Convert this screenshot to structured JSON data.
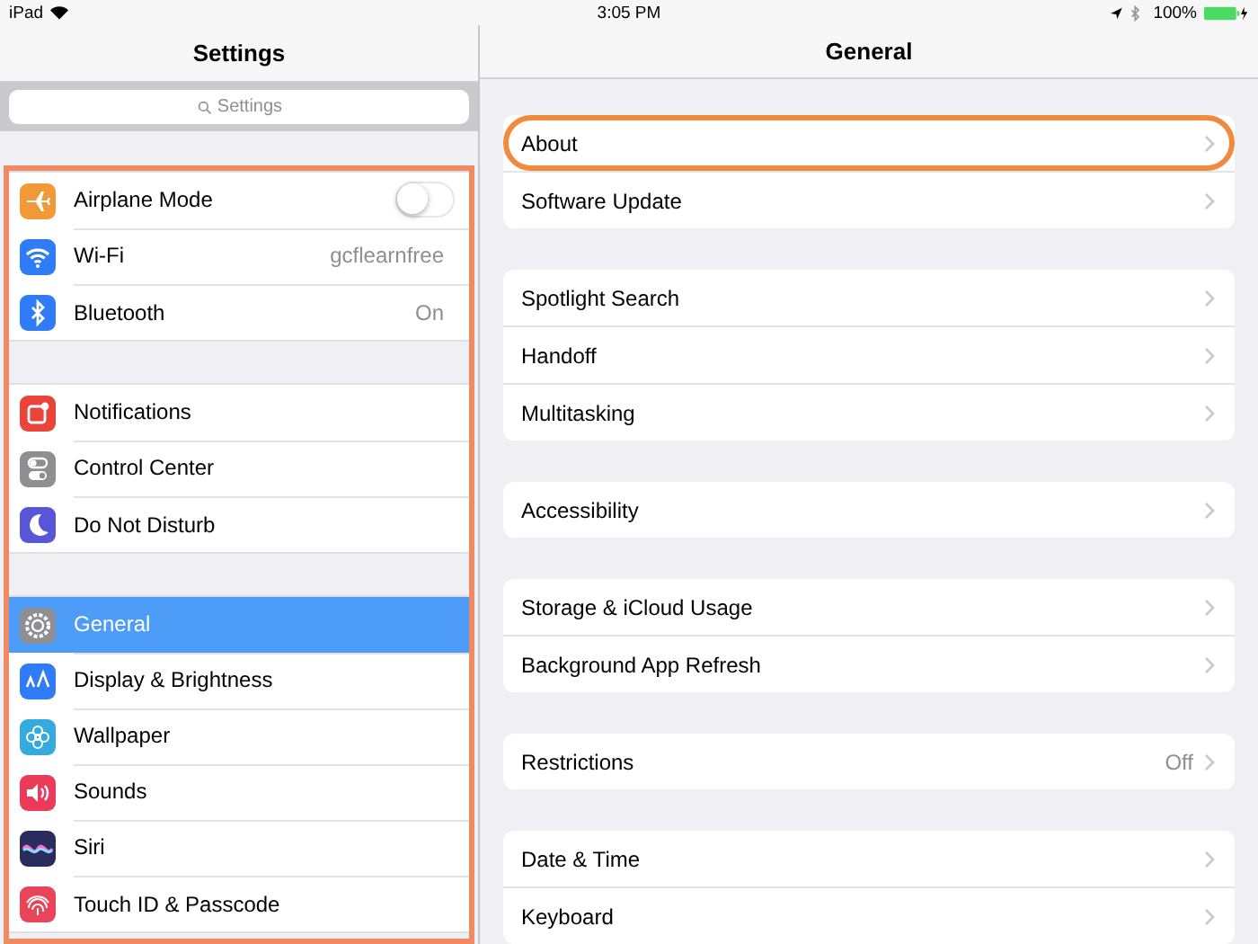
{
  "status_bar": {
    "device": "iPad",
    "time": "3:05 PM",
    "battery": "100%"
  },
  "sidebar": {
    "title": "Settings",
    "search": {
      "placeholder": "Settings"
    },
    "highlighted": true,
    "groups": [
      [
        {
          "label": "Airplane Mode",
          "kind": "toggle",
          "on": false,
          "selected": false,
          "color": "#f19a37"
        },
        {
          "label": "Wi-Fi",
          "kind": "value",
          "value": "gcflearnfree",
          "selected": false,
          "color": "#2f7cf6"
        },
        {
          "label": "Bluetooth",
          "kind": "value",
          "value": "On",
          "selected": false,
          "color": "#2f7cf6"
        }
      ],
      [
        {
          "label": "Notifications",
          "kind": "link",
          "selected": false,
          "color": "#e8443a"
        },
        {
          "label": "Control Center",
          "kind": "link",
          "selected": false,
          "color": "#8e8e93"
        },
        {
          "label": "Do Not Disturb",
          "kind": "link",
          "selected": false,
          "color": "#5856d6"
        }
      ],
      [
        {
          "label": "General",
          "kind": "link",
          "selected": true,
          "color": "#8e8e93"
        },
        {
          "label": "Display & Brightness",
          "kind": "link",
          "selected": false,
          "color": "#2f7cf6"
        },
        {
          "label": "Wallpaper",
          "kind": "link",
          "selected": false,
          "color": "#35aadc"
        },
        {
          "label": "Sounds",
          "kind": "link",
          "selected": false,
          "color": "#eb3b5a"
        },
        {
          "label": "Siri",
          "kind": "link",
          "selected": false,
          "color": "#2a2d5c"
        },
        {
          "label": "Touch ID & Passcode",
          "kind": "link",
          "selected": false,
          "color": "#e8445a"
        }
      ]
    ]
  },
  "detail": {
    "title": "General",
    "groups": [
      [
        {
          "label": "About",
          "highlighted": true
        },
        {
          "label": "Software Update",
          "highlighted": false
        }
      ],
      [
        {
          "label": "Spotlight Search",
          "highlighted": false
        },
        {
          "label": "Handoff",
          "highlighted": false
        },
        {
          "label": "Multitasking",
          "highlighted": false
        }
      ],
      [
        {
          "label": "Accessibility",
          "highlighted": false
        }
      ],
      [
        {
          "label": "Storage & iCloud Usage",
          "highlighted": false
        },
        {
          "label": "Background App Refresh",
          "highlighted": false
        }
      ],
      [
        {
          "label": "Restrictions",
          "value": "Off",
          "highlighted": false
        }
      ],
      [
        {
          "label": "Date & Time",
          "highlighted": false
        },
        {
          "label": "Keyboard",
          "highlighted": false
        }
      ]
    ]
  }
}
